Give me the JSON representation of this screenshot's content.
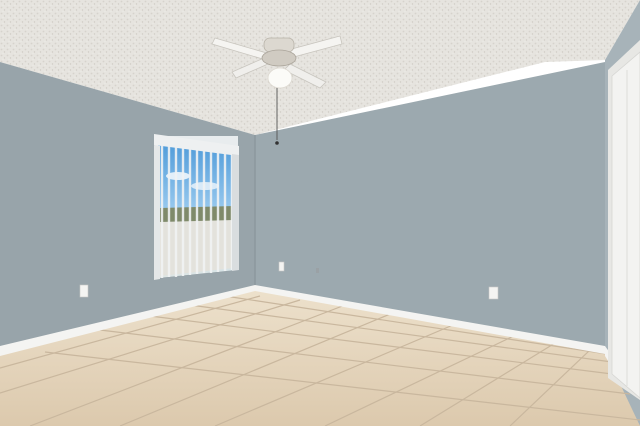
{
  "scene": {
    "description_type": "photo",
    "colors": {
      "ceiling": "#e6e4df",
      "wall_left": "#98a4aa",
      "wall_back": "#9aa7ae",
      "wall_right": "#a5b1b7",
      "floor": "#e6d6be",
      "floor_grout": "#c9b79e",
      "baseboard": "#f4f4f2",
      "sky": "#6fb0e2",
      "door": "#f3f3f1"
    },
    "objects": [
      "ceiling-fan-icon",
      "window-with-vertical-blinds",
      "electrical-outlet",
      "closet-door",
      "tile-floor"
    ]
  }
}
